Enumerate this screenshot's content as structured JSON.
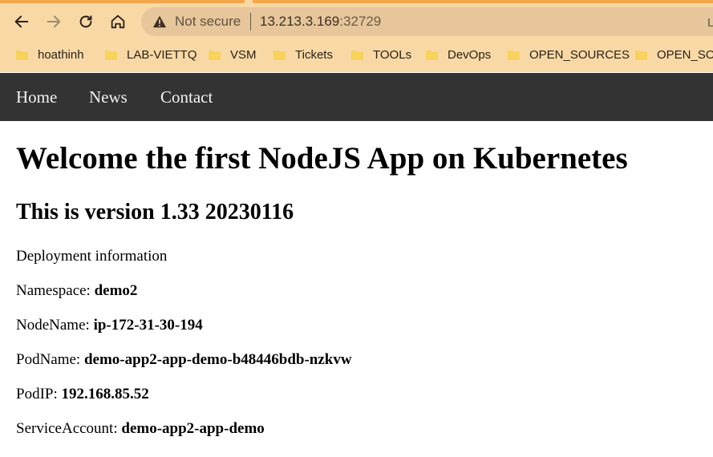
{
  "browser": {
    "security_label": "Not secure",
    "url_host": "13.213.3.169",
    "url_port": ":32729",
    "right_letter": "L",
    "bookmarks": [
      {
        "label": "hoathinh"
      },
      {
        "label": "LAB-VIETTQ"
      },
      {
        "label": "VSM"
      },
      {
        "label": "Tickets"
      },
      {
        "label": "TOOLs"
      },
      {
        "label": "DevOps"
      },
      {
        "label": "OPEN_SOURCES"
      },
      {
        "label": "OPEN_SOU"
      }
    ]
  },
  "nav": {
    "items": [
      {
        "label": "Home"
      },
      {
        "label": "News"
      },
      {
        "label": "Contact"
      }
    ]
  },
  "page": {
    "title": "Welcome the first NodeJS App on Kubernetes",
    "version": "This is version 1.33 20230116",
    "deployment_heading": "Deployment information",
    "fields": [
      {
        "label": "Namespace:",
        "value": "demo2"
      },
      {
        "label": "NodeName:",
        "value": "ip-172-31-30-194"
      },
      {
        "label": "PodName:",
        "value": "demo-app2-app-demo-b48446bdb-nzkvw"
      },
      {
        "label": "PodIP:",
        "value": "192.168.85.52"
      },
      {
        "label": "ServiceAccount:",
        "value": "demo-app2-app-demo"
      }
    ]
  },
  "colors": {
    "chrome_bg": "#f8d9a6",
    "tab_strip": "#f3a64a",
    "omnibox_bg": "#e6c69a",
    "nav_bg": "#333333",
    "nav_text": "#f2f2f2",
    "folder_icon": "#f7d35c"
  }
}
